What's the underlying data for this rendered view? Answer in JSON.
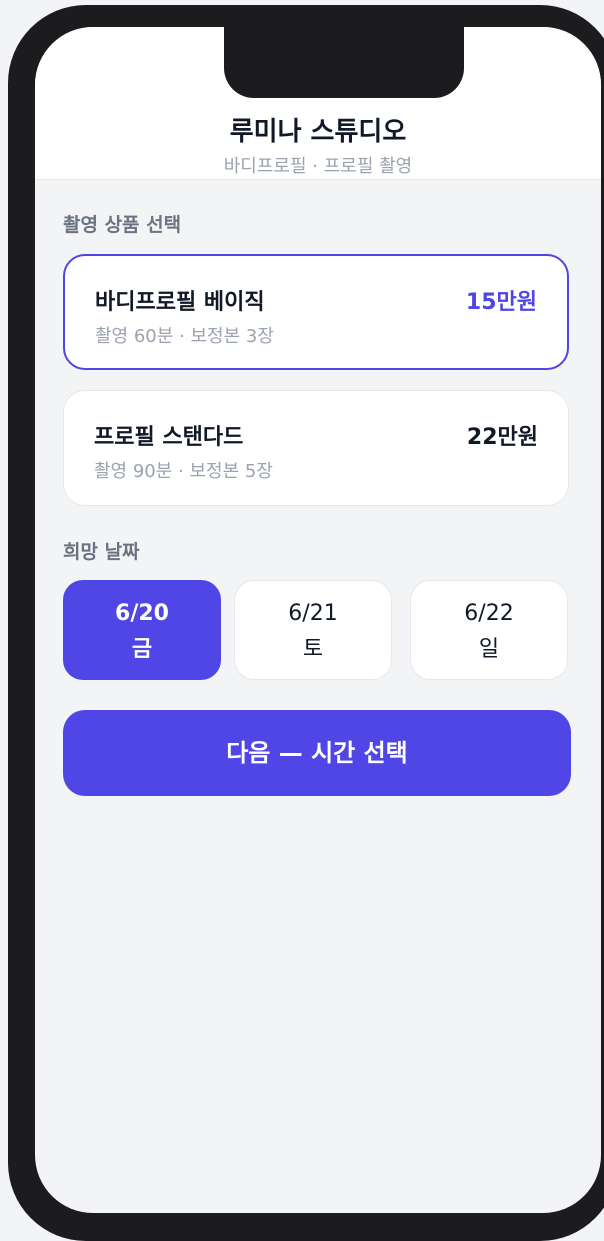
{
  "header": {
    "title": "루미나 스튜디오",
    "subtitle": "바디프로필 · 프로필 촬영"
  },
  "products": {
    "section_label": "촬영 상품 선택",
    "items": [
      {
        "name": "바디프로필 베이직",
        "detail": "촬영 60분 · 보정본 3장",
        "price": "15만원",
        "selected": true
      },
      {
        "name": "프로필 스탠다드",
        "detail": "촬영 90분 · 보정본 5장",
        "price": "22만원",
        "selected": false
      }
    ]
  },
  "dates": {
    "section_label": "희망 날짜",
    "items": [
      {
        "date": "6/20",
        "day": "금",
        "selected": true
      },
      {
        "date": "6/21",
        "day": "토",
        "selected": false
      },
      {
        "date": "6/22",
        "day": "일",
        "selected": false
      }
    ]
  },
  "next_button": {
    "label": "다음 — 시간 선택"
  },
  "colors": {
    "accent": "#5046e5",
    "frame": "#1c1c1e",
    "background": "#f3f4f6"
  }
}
